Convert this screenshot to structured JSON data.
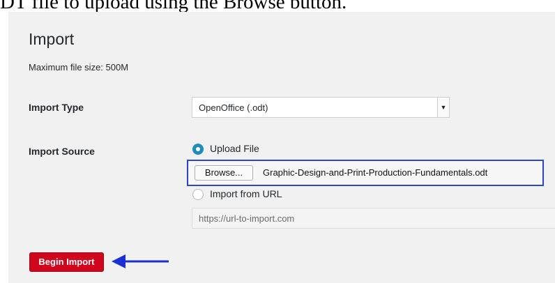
{
  "caption": "DT file to upload using the Browse button.",
  "page": {
    "title": "Import",
    "max_file_size": "Maximum file size: 500M"
  },
  "import_type": {
    "label": "Import Type",
    "selected": "OpenOffice (.odt)"
  },
  "import_source": {
    "label": "Import Source",
    "upload_option_label": "Upload File",
    "upload_selected": true,
    "browse_label": "Browse...",
    "selected_file": "Graphic-Design-and-Print-Production-Fundamentals.odt",
    "url_option_label": "Import from URL",
    "url_placeholder": "https://url-to-import.com"
  },
  "actions": {
    "begin_label": "Begin Import"
  },
  "colors": {
    "accent": "#1e8cbe",
    "primary_button": "#d0061e",
    "highlight_box": "#2b46c8",
    "arrow": "#1a2fd6"
  },
  "icons": {
    "select_arrow": "chevron-down-icon",
    "pointer_arrow": "arrow-left-icon"
  }
}
